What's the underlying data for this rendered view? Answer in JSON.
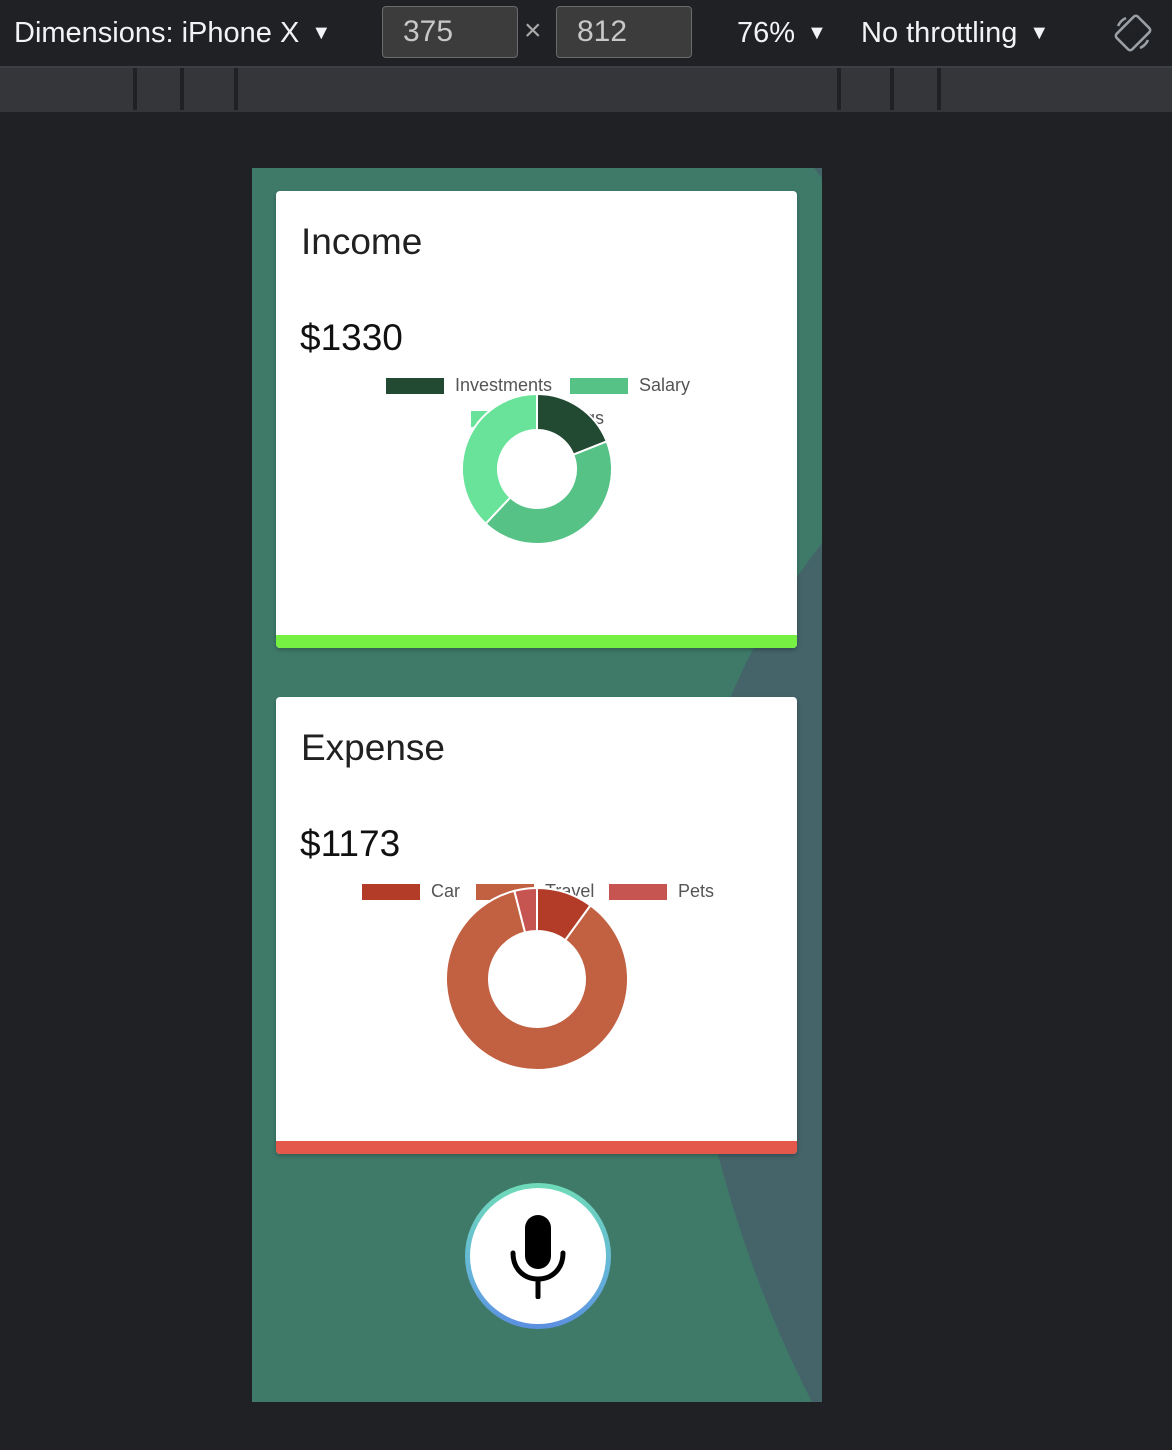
{
  "devtools": {
    "device_label": "Dimensions: iPhone X",
    "width_value": "375",
    "height_value": "812",
    "separator": "×",
    "zoom": "76%",
    "throttling": "No throttling"
  },
  "income": {
    "title": "Income",
    "amount": "$1330",
    "accent_color": "#76f043"
  },
  "expense": {
    "title": "Expense",
    "amount": "$1173",
    "accent_color": "#e4574b"
  },
  "chart_data": [
    {
      "type": "pie",
      "variant": "doughnut",
      "labels": [
        "Investments",
        "Salary",
        "Savings"
      ],
      "values": [
        19,
        43,
        38
      ],
      "colors": [
        "#224932",
        "#56c286",
        "#68e399"
      ],
      "legend": "top"
    },
    {
      "type": "pie",
      "variant": "doughnut",
      "labels": [
        "Car",
        "Travel",
        "Pets"
      ],
      "values": [
        10,
        86,
        4
      ],
      "colors": [
        "#b23c28",
        "#c26042",
        "#c65450"
      ],
      "legend": "top"
    }
  ],
  "mic": {
    "icon": "microphone-icon"
  }
}
